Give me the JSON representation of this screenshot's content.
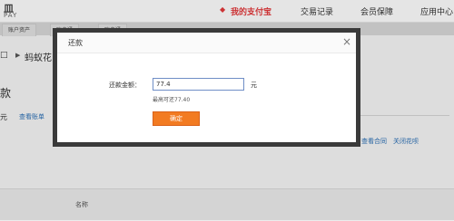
{
  "header": {
    "logo_top": "皿",
    "logo_bottom": "PAY",
    "nav": {
      "active_marker": "◆",
      "my_alipay": "我的支付宝",
      "transactions": "交易记录",
      "member": "会员保障",
      "app_center": "应用中心"
    }
  },
  "subnav": {
    "tabs": [
      "账户资产",
      "账户通",
      "账户通"
    ]
  },
  "background": {
    "crumb_marker": "□",
    "crumb_arrow": "▶",
    "crumb_text": "蚂蚁花",
    "section_title": "款",
    "yuan_fragment": "元",
    "view_bill": "查看账单",
    "view_contract": "查看合同",
    "close_huabei": "关闭花呗",
    "column_name": "名称"
  },
  "modal": {
    "title": "还款",
    "close_glyph": "×",
    "amount_label": "还款金额：",
    "amount_value": "77.4",
    "unit": "元",
    "max_hint": "最高可还77.40",
    "confirm_label": "确定"
  },
  "colors": {
    "accent_red": "#e4393c",
    "confirm_orange": "#f27b22",
    "link_blue": "#2a6fb5"
  }
}
